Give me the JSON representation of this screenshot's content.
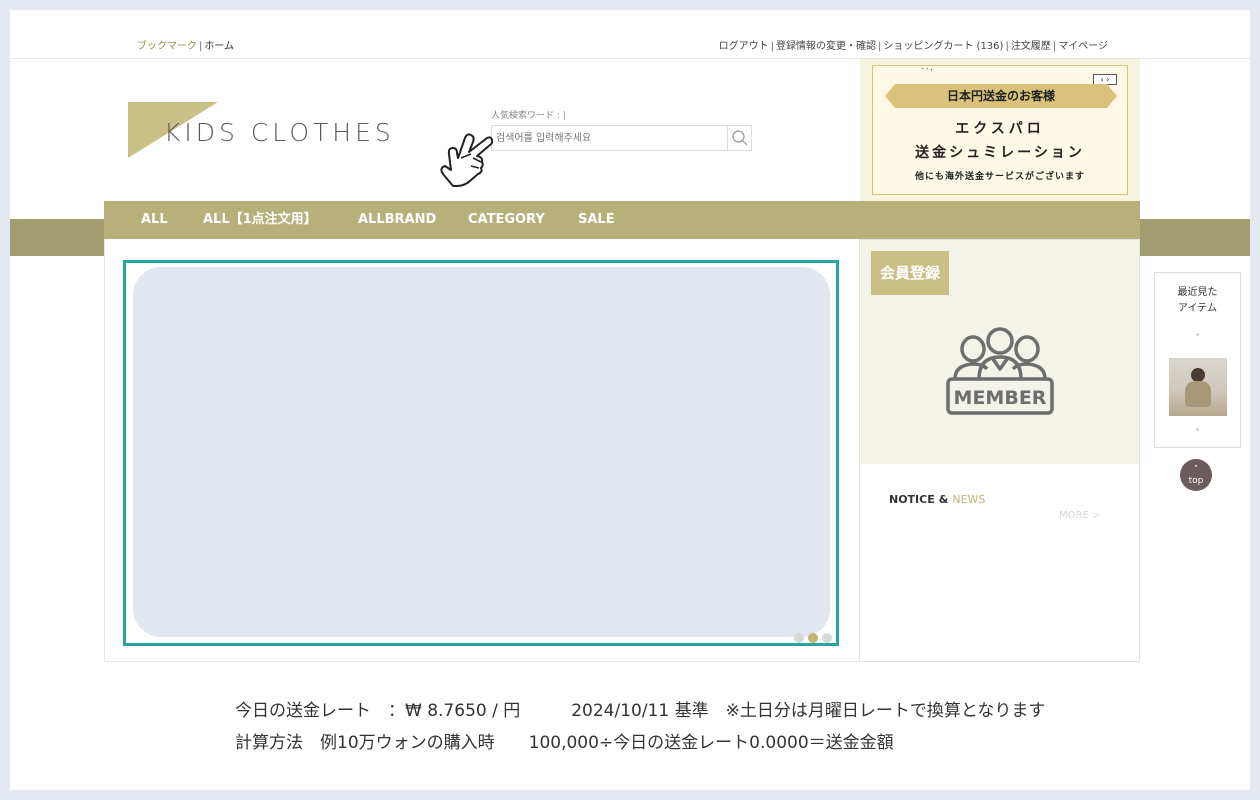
{
  "topbar": {
    "left": {
      "bookmark": "ブックマーク",
      "home": "ホーム"
    },
    "right": {
      "logout": "ログアウト",
      "edit_info": "登録情報の変更・確認",
      "cart": "ショッピングカート (136)",
      "orders": "注文履歴",
      "mypage": "マイページ"
    }
  },
  "logo": {
    "text": "KIDS CLOTHES"
  },
  "search": {
    "popular_label": "人気検索ワード : |",
    "placeholder": "검색어를 입력해주세요"
  },
  "banner": {
    "ribbon": "日本円送金のお客様",
    "line2": "エクスパロ",
    "line3": "送金シュミレーション",
    "line4": "他にも海外送金サービスがございます",
    "arrows": "‹ ›",
    "spark": "``'"
  },
  "nav": {
    "items": [
      "ALL",
      "ALL【1点注文用】",
      "ALLBRAND",
      "CATEGORY",
      "SALE"
    ]
  },
  "sidebar": {
    "member_tag": "会員登録",
    "member_icon_text": "MEMBER",
    "notice_title": "NOTICE",
    "notice_amp": "&",
    "notice_news": "NEWS",
    "more": "MORE >"
  },
  "recent": {
    "title_line1": "最近見た",
    "title_line2": "アイテム",
    "up": "˄",
    "down": "˅",
    "top_label": "top"
  },
  "rate": {
    "line1": "今日の送金レート　：₩ 8.7650 / 円　　　2024/10/11 基準　※土日分は月曜日レートで換算となります",
    "line2": "計算方法　例10万ウォンの購入時　　100,000÷今日の送金レート0.0000＝送金金額"
  },
  "colors": {
    "accent_gold": "#b8b07b",
    "slider_border": "#2aa3a3",
    "member_tag": "#cabf85",
    "news_accent": "#c4b474"
  }
}
